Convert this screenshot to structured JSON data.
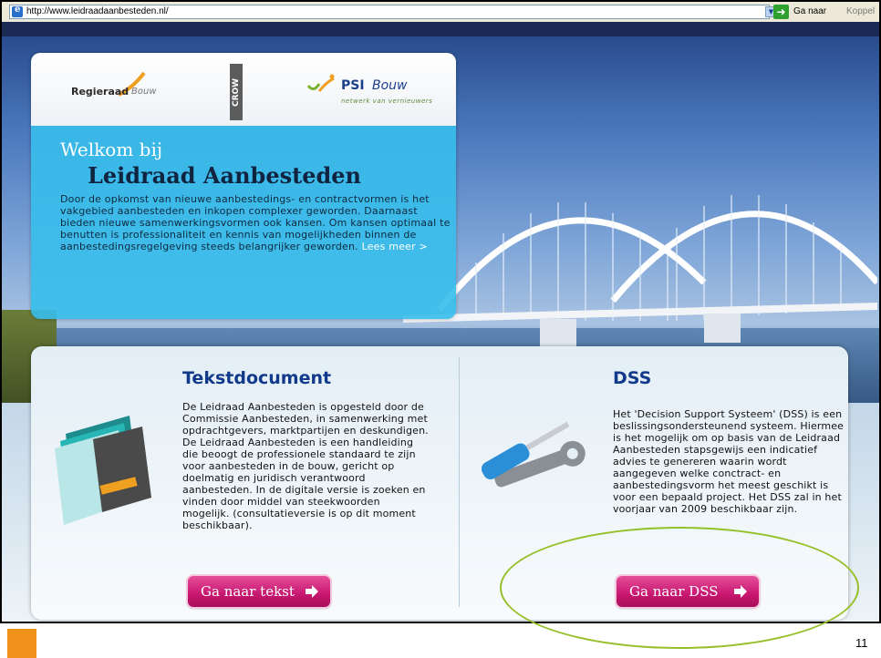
{
  "browser": {
    "url": "http://www.leidraadaanbesteden.nl/",
    "go_label": "Ga naar",
    "links_label": "Koppel"
  },
  "logos": {
    "regieraad": "Regieraad",
    "regieraad_bouw": "Bouw",
    "crow": "CROW",
    "psi": "PSI",
    "psi_bouw": "Bouw",
    "psi_tagline": "netwerk van vernieuwers"
  },
  "welcome": {
    "title": "Welkom bij",
    "subtitle": "Leidraad Aanbesteden",
    "body": "Door de opkomst van nieuwe aanbestedings- en contractvormen is het vakgebied aanbesteden en inkopen complexer geworden. Daarnaast bieden nieuwe samenwerkingsvormen ook kansen. Om kansen optimaal te benutten is professionaliteit en kennis van mogelijkheden binnen de aanbestedingsregelgeving steeds belangrijker geworden.",
    "read_more": "Lees meer >"
  },
  "tekst": {
    "title": "Tekstdocument",
    "body": "De Leidraad Aanbesteden is opgesteld door de Commissie Aanbesteden, in samenwerking met opdrachtgevers, marktpartijen en deskundigen. De Leidraad Aanbesteden is een handleiding die beoogt de professionele standaard te zijn voor aanbesteden in de bouw, gericht op doelmatig en juridisch verantwoord aanbesteden. In de digitale versie is zoeken en vinden door middel van steekwoorden mogelijk. (consultatieversie is op dit moment beschikbaar).",
    "button": "Ga naar tekst"
  },
  "dss": {
    "title": "DSS",
    "body": "Het 'Decision Support Systeem' (DSS) is een beslissingsondersteunend systeem. Hiermee is het mogelijk om op basis van de Leidraad Aanbesteden stapsgewijs een indicatief advies te genereren waarin wordt aangegeven welke conctract- en aanbestedingsvorm het meest geschikt is voor een bepaald project. Het DSS zal in het voorjaar van 2009 beschikbaar zijn.",
    "button": "Ga naar DSS"
  },
  "slide": {
    "page_number": "11"
  },
  "colors": {
    "accent_button": "#c7176f",
    "title_blue": "#123a8a",
    "welcome_panel": "#37beeb",
    "annotation": "#96c02a",
    "slide_marker": "#f0921a"
  }
}
